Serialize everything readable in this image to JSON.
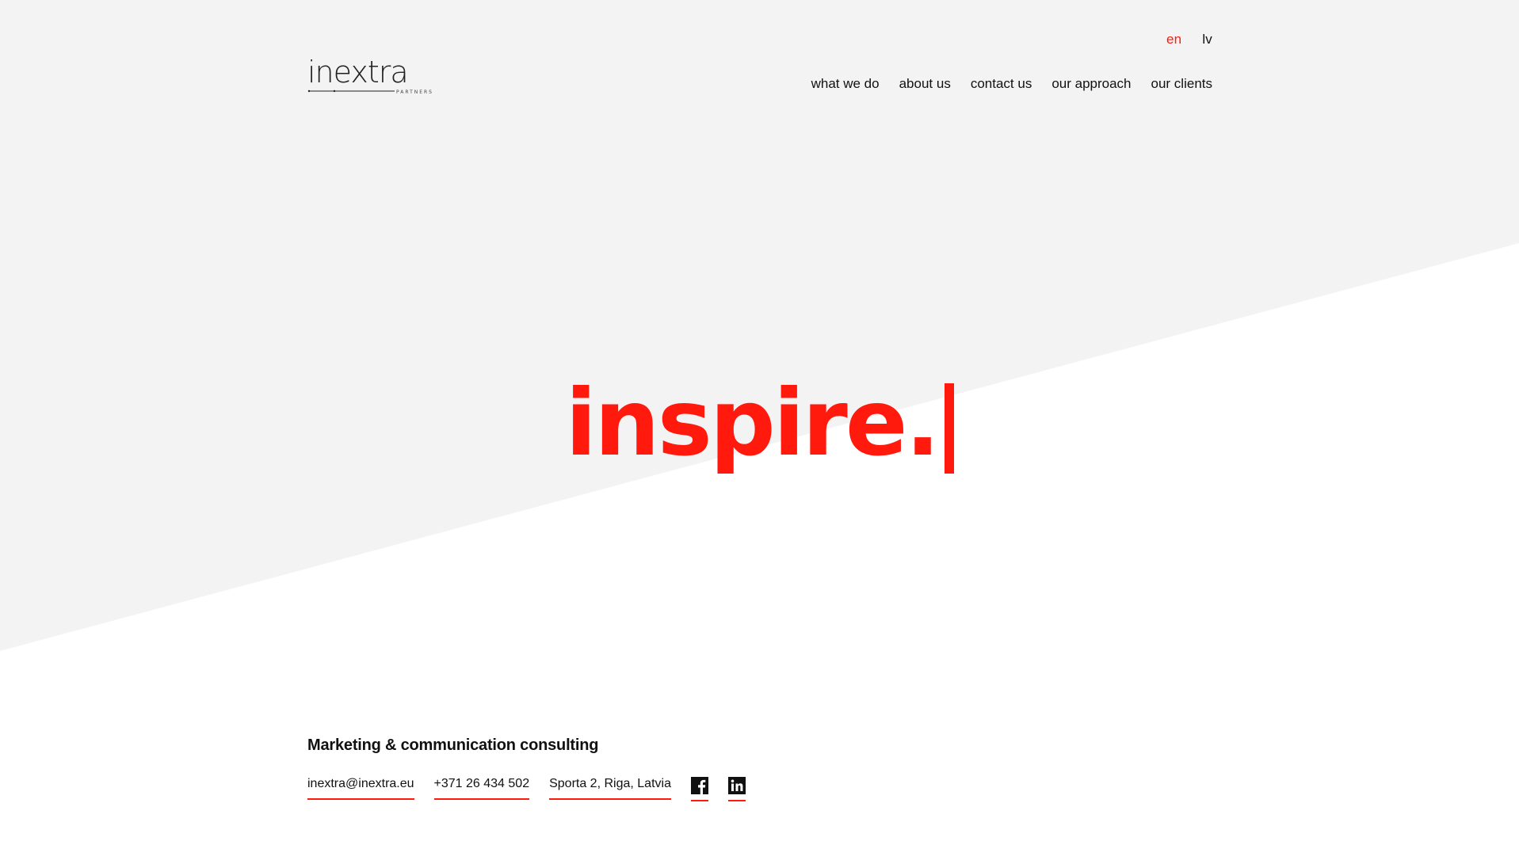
{
  "brand": {
    "logo_text": "inextra",
    "logo_subtext": "PARTNERS",
    "accent_color": "#ff1a0d",
    "background_gray": "#f3f3f3"
  },
  "languages": {
    "en": "en",
    "lv": "lv",
    "active": "en"
  },
  "nav": {
    "what_we_do": "what we do",
    "about_us": "about us",
    "contact_us": "contact us",
    "our_approach": "our approach",
    "our_clients": "our clients"
  },
  "hero": {
    "word": "inspire."
  },
  "footer": {
    "tagline": "Marketing & communication consulting",
    "email": "inextra@inextra.eu",
    "phone": "+371 26 434 502",
    "address": "Sporta 2, Riga, Latvia",
    "social": [
      "facebook-icon",
      "linkedin-icon"
    ]
  }
}
